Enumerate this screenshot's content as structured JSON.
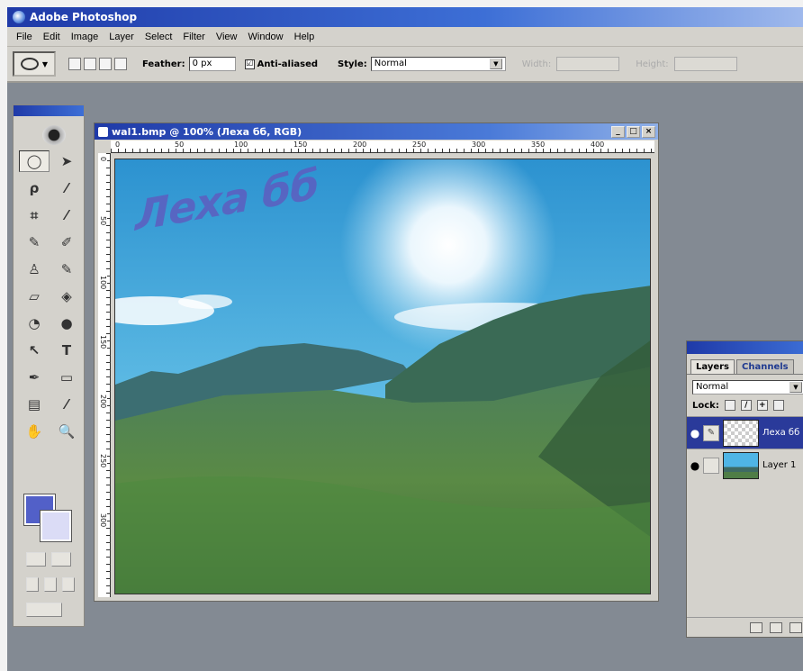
{
  "app": {
    "title": "Adobe Photoshop"
  },
  "menu": [
    "File",
    "Edit",
    "Image",
    "Layer",
    "Select",
    "Filter",
    "View",
    "Window",
    "Help"
  ],
  "options_bar": {
    "feather_label": "Feather:",
    "feather_value": "0 px",
    "antialiased_label": "Anti-aliased",
    "antialiased_checked": "☑",
    "style_label": "Style:",
    "style_value": "Normal",
    "width_label": "Width:",
    "height_label": "Height:"
  },
  "toolbox": {
    "tools": [
      {
        "name": "elliptical-marquee-tool-icon",
        "glyph": "◯"
      },
      {
        "name": "move-tool-icon",
        "glyph": "➤"
      },
      {
        "name": "lasso-tool-icon",
        "glyph": "ρ"
      },
      {
        "name": "magic-wand-tool-icon",
        "glyph": "⁄"
      },
      {
        "name": "crop-tool-icon",
        "glyph": "⌗"
      },
      {
        "name": "slice-tool-icon",
        "glyph": "⁄"
      },
      {
        "name": "healing-brush-tool-icon",
        "glyph": "✎"
      },
      {
        "name": "brush-tool-icon",
        "glyph": "✐"
      },
      {
        "name": "clone-stamp-tool-icon",
        "glyph": "♙"
      },
      {
        "name": "history-brush-tool-icon",
        "glyph": "✎"
      },
      {
        "name": "eraser-tool-icon",
        "glyph": "▱"
      },
      {
        "name": "paint-bucket-tool-icon",
        "glyph": "◈"
      },
      {
        "name": "blur-tool-icon",
        "glyph": "◔"
      },
      {
        "name": "dodge-tool-icon",
        "glyph": "●"
      },
      {
        "name": "path-selection-tool-icon",
        "glyph": "↖"
      },
      {
        "name": "type-tool-icon",
        "glyph": "T"
      },
      {
        "name": "pen-tool-icon",
        "glyph": "✒"
      },
      {
        "name": "shape-tool-icon",
        "glyph": "▭"
      },
      {
        "name": "notes-tool-icon",
        "glyph": "▤"
      },
      {
        "name": "eyedropper-tool-icon",
        "glyph": "⁄"
      },
      {
        "name": "hand-tool-icon",
        "glyph": "✋"
      },
      {
        "name": "zoom-tool-icon",
        "glyph": "🔍"
      }
    ],
    "foreground_color": "#5260c8",
    "background_color": "#dbdcf6"
  },
  "document": {
    "title": "wal1.bmp @ 100% (Леха бб, RGB)",
    "watermark_text": "Леха бб",
    "hruler_ticks": [
      "0",
      "50",
      "100",
      "150",
      "200",
      "250",
      "300",
      "350",
      "400"
    ],
    "vruler_ticks": [
      "0",
      "50",
      "100",
      "150",
      "200",
      "250",
      "300"
    ]
  },
  "layers_panel": {
    "tabs": [
      "Layers",
      "Channels"
    ],
    "blend_mode": "Normal",
    "lock_label": "Lock:",
    "layers": [
      {
        "name": "Леха бб",
        "selected": true
      },
      {
        "name": "Layer 1",
        "selected": false
      }
    ]
  },
  "colors": {
    "title_bar": "#1f3aa8",
    "chrome": "#d4d2cc",
    "workspace": "#838a93",
    "watermark": "#5f5bbf"
  }
}
